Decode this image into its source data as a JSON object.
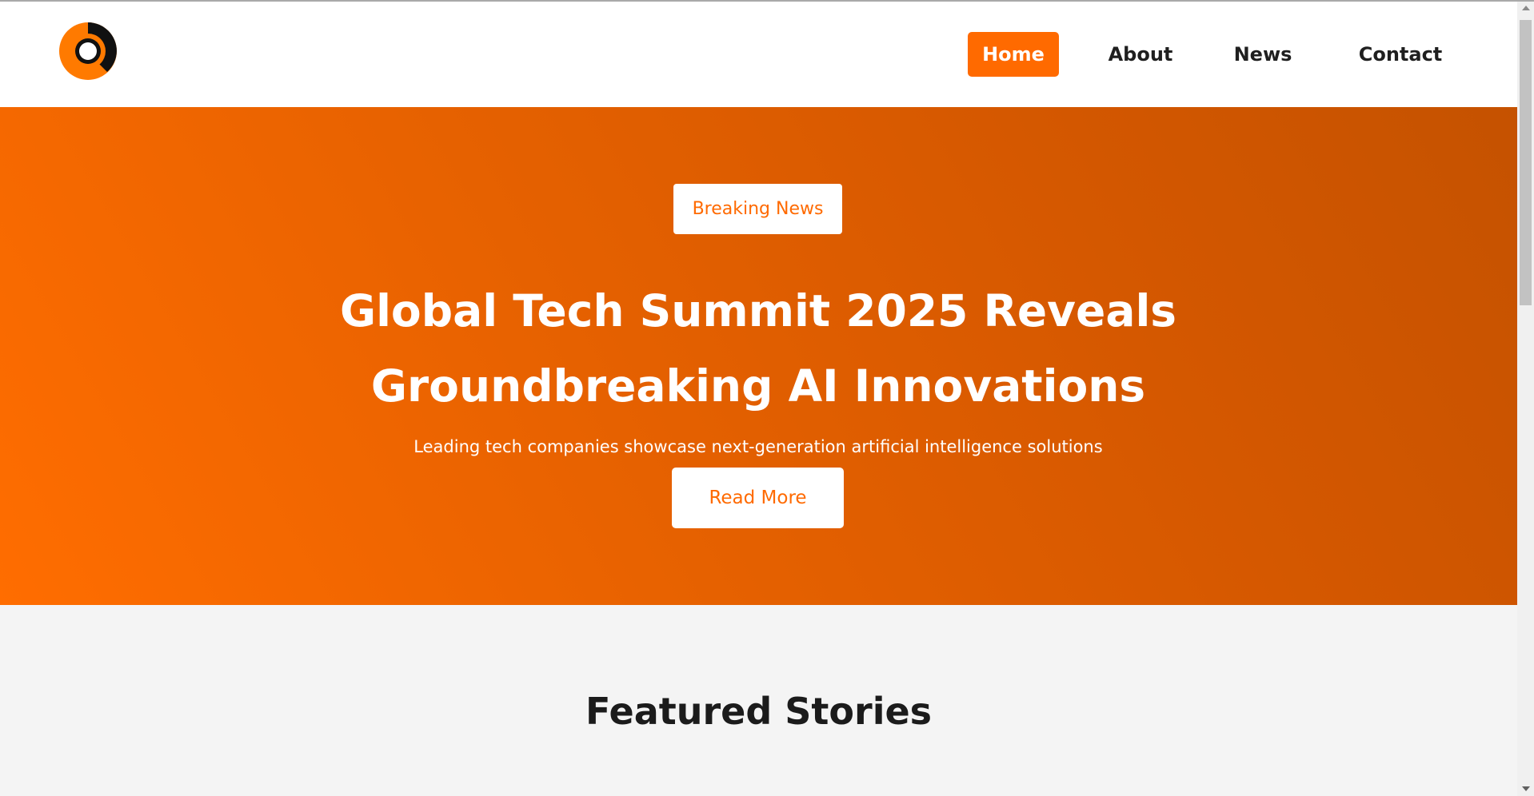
{
  "colors": {
    "accent": "#ff6a00",
    "hero_gradient_start": "#ff6d00",
    "hero_gradient_end": "#c55200",
    "header_bg": "#ffffff",
    "section_bg": "#f4f4f4",
    "text_dark": "#1f1f1f"
  },
  "header": {
    "logo_icon": "orange-ring-logo-icon",
    "nav": [
      {
        "label": "Home",
        "active": true
      },
      {
        "label": "About",
        "active": false
      },
      {
        "label": "News",
        "active": false
      },
      {
        "label": "Contact",
        "active": false
      }
    ]
  },
  "hero": {
    "tag": "Breaking News",
    "headline": "Global Tech Summit 2025 Reveals Groundbreaking AI Innovations",
    "subline": "Leading tech companies showcase next-generation artificial intelligence solutions",
    "cta_label": "Read More"
  },
  "featured": {
    "title": "Featured Stories"
  },
  "scrollbar": {
    "icons": [
      "scroll-up-arrow-icon",
      "scroll-down-arrow-icon"
    ]
  }
}
